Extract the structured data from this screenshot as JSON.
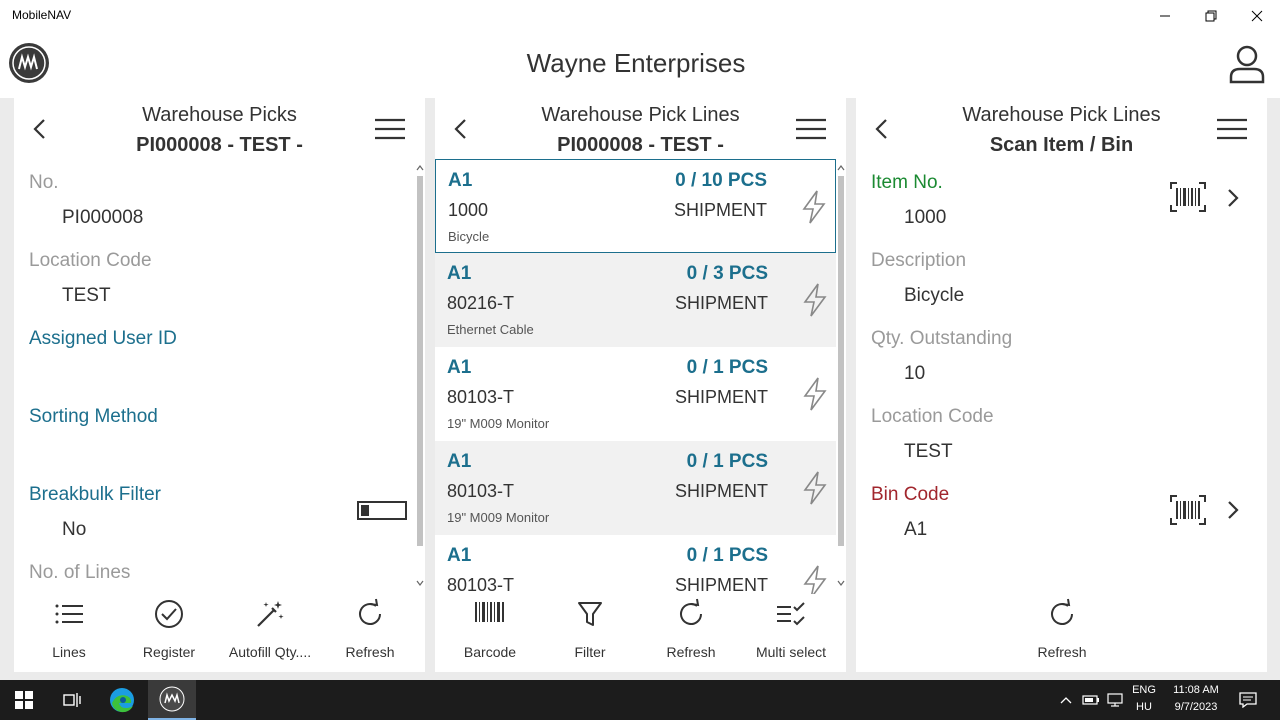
{
  "window": {
    "title": "MobileNAV"
  },
  "header": {
    "company": "Wayne Enterprises"
  },
  "left_panel": {
    "title": "Warehouse Picks",
    "subtitle": "PI000008 - TEST -",
    "fields": {
      "no_label": "No.",
      "no_value": "PI000008",
      "location_label": "Location Code",
      "location_value": "TEST",
      "assigned_label": "Assigned User ID",
      "sorting_label": "Sorting Method",
      "breakbulk_label": "Breakbulk Filter",
      "breakbulk_value": "No",
      "lines_label": "No. of Lines"
    },
    "toolbar": {
      "lines": "Lines",
      "register": "Register",
      "autofill": "Autofill Qty....",
      "refresh": "Refresh"
    }
  },
  "middle_panel": {
    "title": "Warehouse Pick Lines",
    "subtitle": "PI000008 - TEST -",
    "lines": [
      {
        "bin": "A1",
        "qty": "0 / 10 PCS",
        "item": "1000",
        "type": "SHIPMENT",
        "desc": "Bicycle"
      },
      {
        "bin": "A1",
        "qty": "0 / 3 PCS",
        "item": "80216-T",
        "type": "SHIPMENT",
        "desc": "Ethernet Cable"
      },
      {
        "bin": "A1",
        "qty": "0 / 1 PCS",
        "item": "80103-T",
        "type": "SHIPMENT",
        "desc": "19\" M009 Monitor"
      },
      {
        "bin": "A1",
        "qty": "0 / 1 PCS",
        "item": "80103-T",
        "type": "SHIPMENT",
        "desc": "19\" M009 Monitor"
      },
      {
        "bin": "A1",
        "qty": "0 / 1 PCS",
        "item": "80103-T",
        "type": "SHIPMENT",
        "desc": ""
      }
    ],
    "toolbar": {
      "barcode": "Barcode",
      "filter": "Filter",
      "refresh": "Refresh",
      "multiselect": "Multi select"
    }
  },
  "right_panel": {
    "title": "Warehouse Pick Lines",
    "subtitle": "Scan Item / Bin",
    "fields": {
      "item_label": "Item No.",
      "item_value": "1000",
      "desc_label": "Description",
      "desc_value": "Bicycle",
      "qty_label": "Qty. Outstanding",
      "qty_value": "10",
      "location_label": "Location Code",
      "location_value": "TEST",
      "bin_label": "Bin Code",
      "bin_value": "A1"
    },
    "toolbar": {
      "refresh": "Refresh"
    }
  },
  "taskbar": {
    "lang1": "ENG",
    "lang2": "HU",
    "time": "11:08 AM",
    "date": "9/7/2023"
  },
  "colors": {
    "accent_blue": "#1c6f8d",
    "green": "#1b8a32",
    "red": "#a1262d"
  }
}
